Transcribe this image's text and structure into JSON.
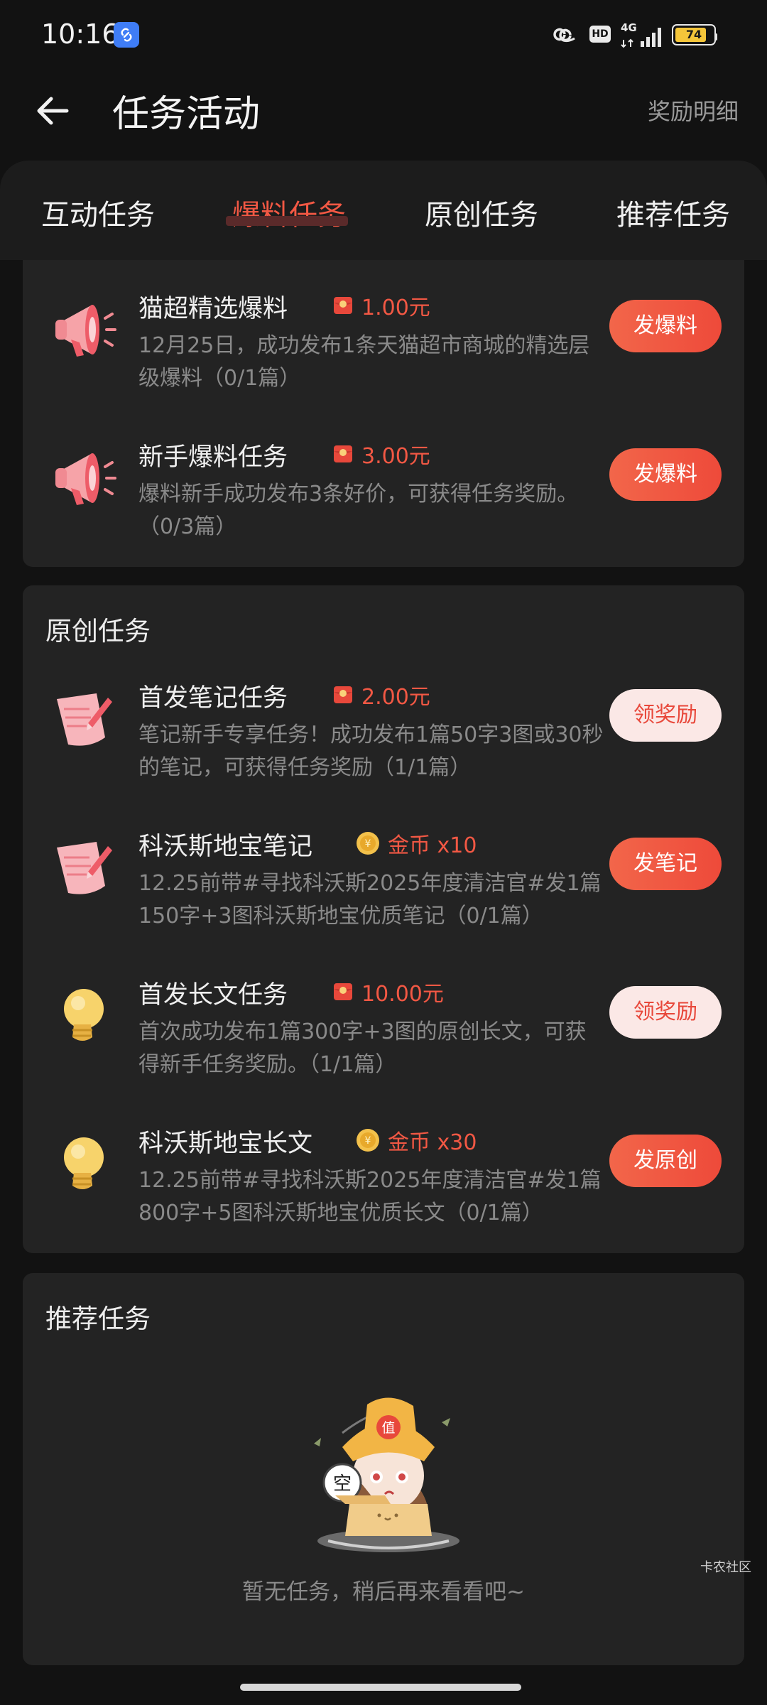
{
  "status_bar": {
    "time": "10:16",
    "network": "4G",
    "hd": "HD",
    "battery": "74"
  },
  "header": {
    "title": "任务活动",
    "reward_detail": "奖励明细"
  },
  "tabs": [
    {
      "label": "互动任务",
      "active": false
    },
    {
      "label": "爆料任务",
      "active": true
    },
    {
      "label": "原创任务",
      "active": false
    },
    {
      "label": "推荐任务",
      "active": false
    }
  ],
  "baoliao_tasks": [
    {
      "name": "猫超精选爆料",
      "reward_icon": "red-envelope-icon",
      "reward": "1.00元",
      "desc": "12月25日，成功发布1条天猫超市商城的精选层级爆料（0/1篇）",
      "button": "发爆料",
      "button_style": "primary",
      "icon": "megaphone-icon"
    },
    {
      "name": "新手爆料任务",
      "reward_icon": "red-envelope-icon",
      "reward": "3.00元",
      "desc": "爆料新手成功发布3条好价，可获得任务奖励。（0/3篇）",
      "button": "发爆料",
      "button_style": "primary",
      "icon": "megaphone-icon"
    }
  ],
  "original": {
    "title": "原创任务",
    "tasks": [
      {
        "name": "首发笔记任务",
        "reward_icon": "red-envelope-icon",
        "reward": "2.00元",
        "desc": "笔记新手专享任务！成功发布1篇50字3图或30秒的笔记，可获得任务奖励（1/1篇）",
        "button": "领奖励",
        "button_style": "claim",
        "icon": "notepad-icon"
      },
      {
        "name": "科沃斯地宝笔记",
        "reward_icon": "gold-coin-icon",
        "reward": "金币 x10",
        "desc": "12.25前带#寻找科沃斯2025年度清洁官#发1篇150字+3图科沃斯地宝优质笔记（0/1篇）",
        "button": "发笔记",
        "button_style": "primary",
        "icon": "notepad-icon"
      },
      {
        "name": "首发长文任务",
        "reward_icon": "red-envelope-icon",
        "reward": "10.00元",
        "desc": "首次成功发布1篇300字+3图的原创长文，可获得新手任务奖励。（1/1篇）",
        "button": "领奖励",
        "button_style": "claim",
        "icon": "lightbulb-icon"
      },
      {
        "name": "科沃斯地宝长文",
        "reward_icon": "gold-coin-icon",
        "reward": "金币 x30",
        "desc": "12.25前带#寻找科沃斯2025年度清洁官#发1篇800字+5图科沃斯地宝优质长文（0/1篇）",
        "button": "发原创",
        "button_style": "primary",
        "icon": "lightbulb-icon"
      }
    ]
  },
  "recommend": {
    "title": "推荐任务",
    "empty_text": "暂无任务，稍后再来看看吧~",
    "mascot_hat_text": "值",
    "mascot_bubble_text": "空"
  },
  "watermark": "卡农社区",
  "colors": {
    "accent": "#f25844",
    "background": "#121212",
    "card": "#232323",
    "claim_bg": "#fbe8e6"
  }
}
